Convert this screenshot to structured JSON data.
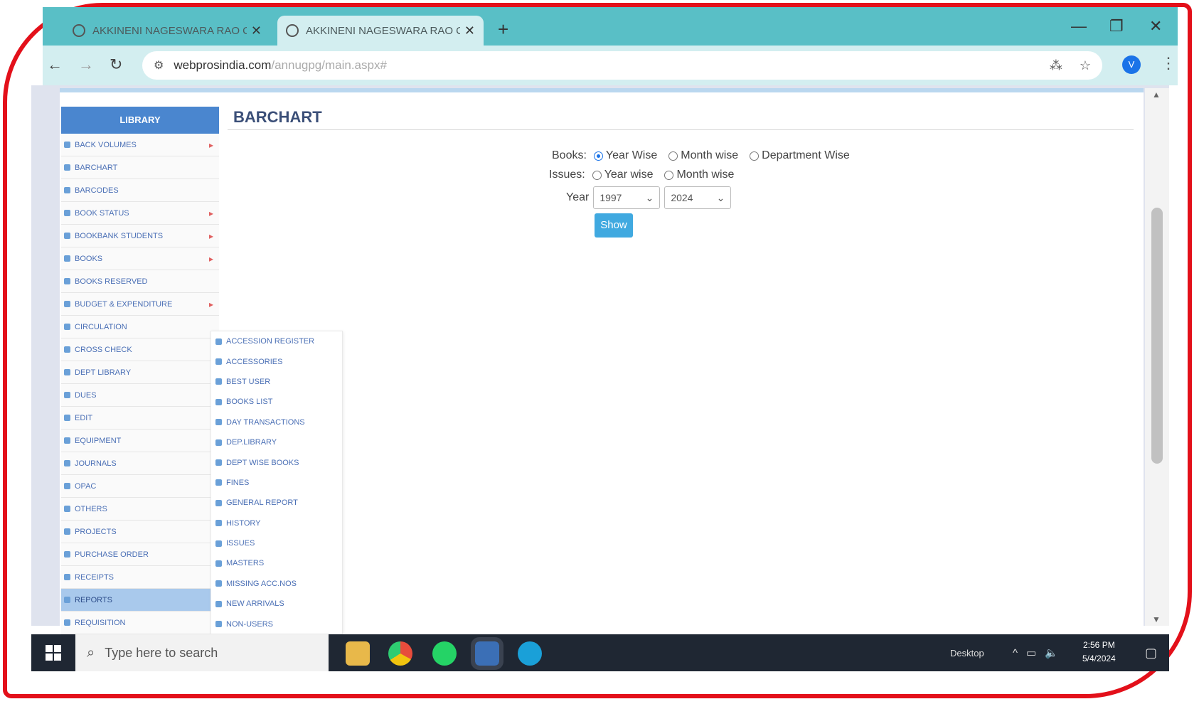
{
  "browser": {
    "tabs": [
      {
        "title": "AKKINENI NAGESWARA RAO C"
      },
      {
        "title": "AKKINENI NAGESWARA RAO C"
      }
    ],
    "new_tab": "+",
    "url_main": "webprosindia.com",
    "url_rest": "/annugpg/main.aspx#",
    "profile_initial": "V"
  },
  "sidebar": {
    "header": "LIBRARY",
    "items": [
      {
        "label": "BACK VOLUMES",
        "has_sub": true
      },
      {
        "label": "BARCHART",
        "has_sub": false
      },
      {
        "label": "BARCODES",
        "has_sub": false
      },
      {
        "label": "BOOK STATUS",
        "has_sub": true
      },
      {
        "label": "BOOKBANK STUDENTS",
        "has_sub": true
      },
      {
        "label": "BOOKS",
        "has_sub": true
      },
      {
        "label": "BOOKS RESERVED",
        "has_sub": false
      },
      {
        "label": "BUDGET & EXPENDITURE",
        "has_sub": true
      },
      {
        "label": "CIRCULATION",
        "has_sub": false
      },
      {
        "label": "CROSS CHECK",
        "has_sub": false
      },
      {
        "label": "DEPT LIBRARY",
        "has_sub": false
      },
      {
        "label": "DUES",
        "has_sub": false
      },
      {
        "label": "EDIT",
        "has_sub": false
      },
      {
        "label": "EQUIPMENT",
        "has_sub": false
      },
      {
        "label": "JOURNALS",
        "has_sub": false
      },
      {
        "label": "OPAC",
        "has_sub": false
      },
      {
        "label": "OTHERS",
        "has_sub": false
      },
      {
        "label": "PROJECTS",
        "has_sub": false
      },
      {
        "label": "PURCHASE ORDER",
        "has_sub": false
      },
      {
        "label": "RECEIPTS",
        "has_sub": false
      },
      {
        "label": "REPORTS",
        "has_sub": false,
        "active": true
      },
      {
        "label": "REQUISITION",
        "has_sub": false
      }
    ]
  },
  "submenu": {
    "items": [
      "ACCESSION REGISTER",
      "ACCESSORIES",
      "BEST USER",
      "BOOKS LIST",
      "DAY TRANSACTIONS",
      "DEP.LIBRARY",
      "DEPT WISE BOOKS",
      "FINES",
      "GENERAL REPORT",
      "HISTORY",
      "ISSUES",
      "MASTERS",
      "MISSING ACC.NOS",
      "NEW ARRIVALS",
      "NON-USERS"
    ]
  },
  "content": {
    "title": "BARCHART",
    "books_label": "Books:",
    "books_options": [
      {
        "label": "Year Wise",
        "checked": true
      },
      {
        "label": "Month wise",
        "checked": false
      },
      {
        "label": "Department Wise",
        "checked": false
      }
    ],
    "issues_label": "Issues:",
    "issues_options": [
      {
        "label": "Year wise",
        "checked": false
      },
      {
        "label": "Month wise",
        "checked": false
      }
    ],
    "year_label": "Year",
    "year_from": "1997",
    "year_to": "2024",
    "show_button": "Show"
  },
  "taskbar": {
    "search_placeholder": "Type here to search",
    "desktop_label": "Desktop",
    "time": "2:56 PM",
    "date": "5/4/2024"
  },
  "colors": {
    "accent": "#4a86cf",
    "button": "#40a9e0",
    "frame": "#e3101a"
  }
}
